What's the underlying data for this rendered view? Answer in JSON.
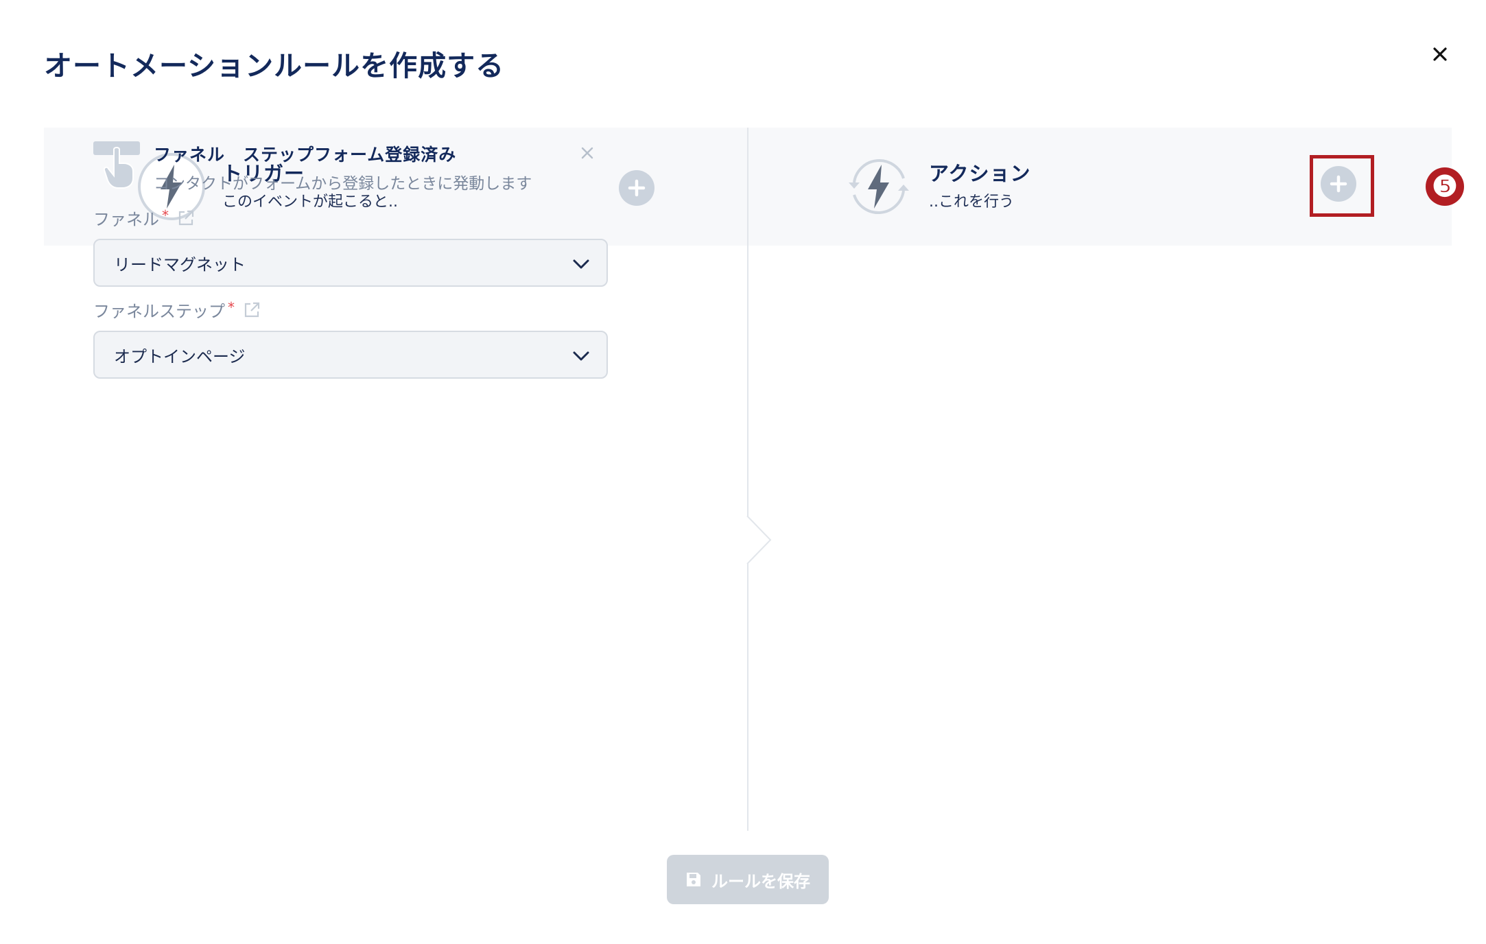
{
  "modal": {
    "title": "オートメーションルールを作成する",
    "close_icon": "close-icon"
  },
  "trigger_column": {
    "title": "トリガー",
    "subtitle": "このイベントが起こると..",
    "icon": "lightning-icon",
    "add_icon": "plus-circle-icon"
  },
  "action_column": {
    "title": "アクション",
    "subtitle": "..これを行う",
    "icon": "lightning-cycle-icon",
    "add_icon": "plus-circle-icon",
    "highlighted": true,
    "step_badge": "❺"
  },
  "trigger_card": {
    "icon": "tap-hand-icon",
    "title": "ファネル　ステップフォーム登録済み",
    "description": "コンタクトがフォームから登録したときに発動します",
    "remove_icon": "close-icon",
    "fields": [
      {
        "label": "ファネル",
        "required_mark": "*",
        "value": "リードマグネット",
        "link_icon": "external-link-icon"
      },
      {
        "label": "ファネルステップ",
        "required_mark": "*",
        "value": "オプトインページ",
        "link_icon": "external-link-icon"
      }
    ]
  },
  "footer": {
    "save_label": "ルールを保存",
    "save_icon": "save-icon",
    "save_disabled": true
  },
  "colors": {
    "title": "#13295b",
    "accent_highlight": "#b21e23",
    "header_band": "#f7f8fa",
    "muted_text": "#7a879c",
    "required": "#e5484d",
    "disabled_button": "#cfd5dc"
  }
}
